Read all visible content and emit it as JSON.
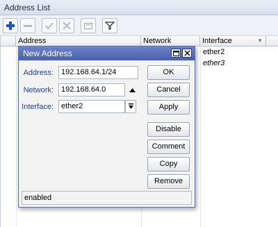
{
  "window": {
    "title": "Address List"
  },
  "toolbar": {
    "buttons": [
      "add-icon",
      "remove-icon",
      "enable-icon",
      "disable-icon",
      "comment-icon",
      "filter-icon"
    ]
  },
  "grid": {
    "columns": [
      "Address",
      "Network",
      "Interface"
    ],
    "rows": [
      {
        "interface": "ether2",
        "italic": false
      },
      {
        "interface": "ether3",
        "italic": true
      }
    ]
  },
  "dialog": {
    "title": "New Address",
    "fields": {
      "address": {
        "label": "Address:",
        "value": "192.168.64.1/24"
      },
      "network": {
        "label": "Network:",
        "value": "192.168.64.0"
      },
      "interface": {
        "label": "Interface:",
        "value": "ether2"
      }
    },
    "buttons": {
      "ok": "OK",
      "cancel": "Cancel",
      "apply": "Apply",
      "disable": "Disable",
      "comment": "Comment",
      "copy": "Copy",
      "remove": "Remove"
    },
    "status": "enabled"
  },
  "colors": {
    "dialog_title": "#4a5fb0",
    "label_blue": "#1a3fa8",
    "add_icon": "#1a4fd0"
  }
}
